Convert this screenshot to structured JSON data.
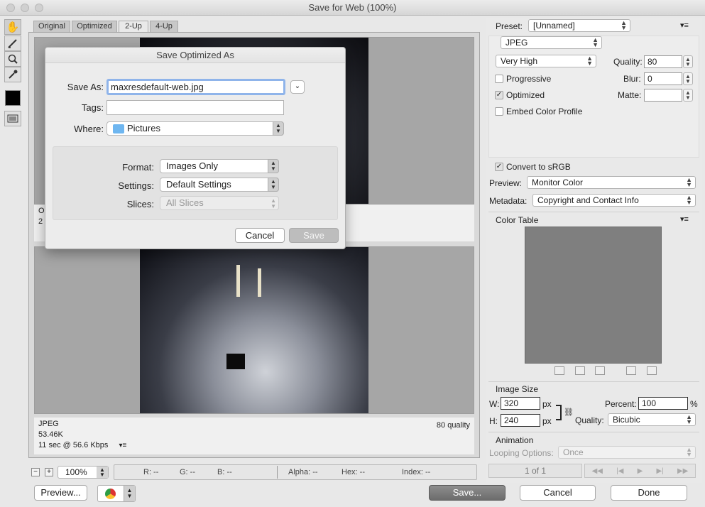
{
  "window": {
    "title": "Save for Web (100%)"
  },
  "tabs": [
    "Original",
    "Optimized",
    "2-Up",
    "4-Up"
  ],
  "active_tab": "2-Up",
  "top_pane": {
    "partial_info_lines": [
      "O",
      "2"
    ]
  },
  "bottom_pane": {
    "format": "JPEG",
    "size": "53.46K",
    "download": "11 sec @ 56.6 Kbps",
    "quality_note": "80 quality"
  },
  "status_bar": {
    "zoom": "100%",
    "r": "R: --",
    "g": "G: --",
    "b": "B: --",
    "alpha": "Alpha: --",
    "hex": "Hex: --",
    "index": "Index: --"
  },
  "bottom_buttons": {
    "preview": "Preview...",
    "save": "Save...",
    "cancel": "Cancel",
    "done": "Done"
  },
  "settings": {
    "preset_label": "Preset:",
    "preset_value": "[Unnamed]",
    "format_value": "JPEG",
    "compression_value": "Very High",
    "quality_label": "Quality:",
    "quality_value": "80",
    "progressive_label": "Progressive",
    "progressive_checked": false,
    "blur_label": "Blur:",
    "blur_value": "0",
    "optimized_label": "Optimized",
    "optimized_checked": true,
    "matte_label": "Matte:",
    "matte_value": "",
    "embed_label": "Embed Color Profile",
    "embed_checked": false,
    "convert_label": "Convert to sRGB",
    "convert_checked": true,
    "preview_label": "Preview:",
    "preview_value": "Monitor Color",
    "metadata_label": "Metadata:",
    "metadata_value": "Copyright and Contact Info"
  },
  "color_table": {
    "title": "Color Table"
  },
  "image_size": {
    "title": "Image Size",
    "w_label": "W:",
    "w_value": "320",
    "w_unit": "px",
    "h_label": "H:",
    "h_value": "240",
    "h_unit": "px",
    "percent_label": "Percent:",
    "percent_value": "100",
    "percent_unit": "%",
    "quality_label": "Quality:",
    "quality_value": "Bicubic"
  },
  "animation": {
    "title": "Animation",
    "looping_label": "Looping Options:",
    "looping_value": "Once",
    "frame_counter": "1 of 1"
  },
  "dialog": {
    "title": "Save Optimized As",
    "save_as_label": "Save As:",
    "save_as_value": "maxresdefault-web.jpg",
    "tags_label": "Tags:",
    "tags_value": "",
    "where_label": "Where:",
    "where_value": "Pictures",
    "format_label": "Format:",
    "format_value": "Images Only",
    "settings_label": "Settings:",
    "settings_value": "Default Settings",
    "slices_label": "Slices:",
    "slices_value": "All Slices",
    "cancel": "Cancel",
    "save": "Save"
  }
}
